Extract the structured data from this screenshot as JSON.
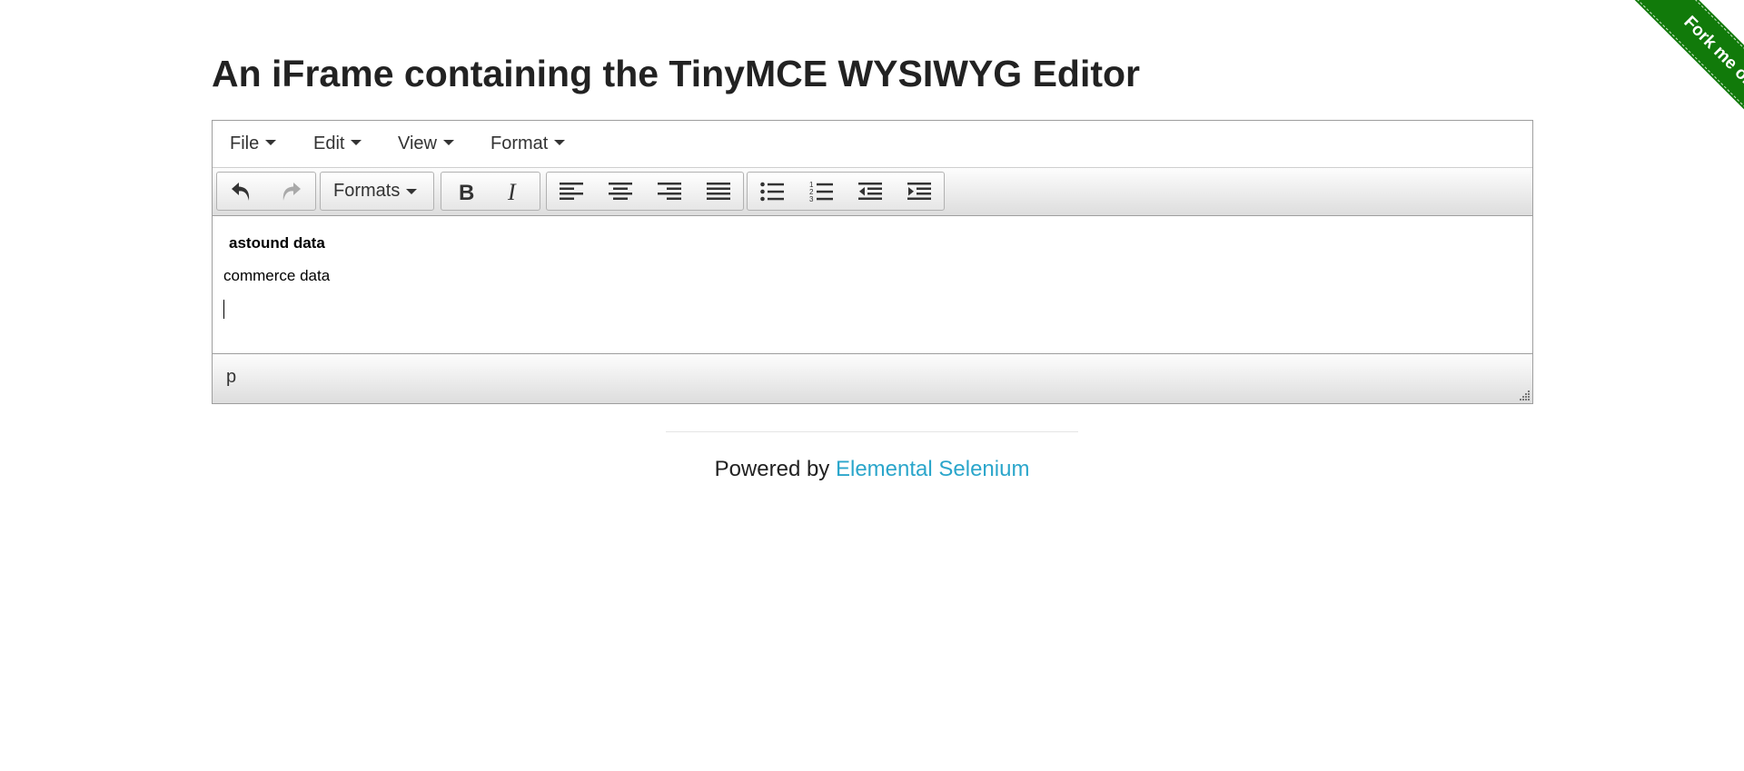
{
  "page": {
    "title": "An iFrame containing the TinyMCE WYSIWYG Editor"
  },
  "ribbon": {
    "label": "Fork me on GitHub",
    "color": "#117a0a"
  },
  "menubar": {
    "items": [
      {
        "label": "File"
      },
      {
        "label": "Edit"
      },
      {
        "label": "View"
      },
      {
        "label": "Format"
      }
    ]
  },
  "toolbar": {
    "formats_label": "Formats",
    "buttons": [
      {
        "icon": "undo-icon",
        "enabled": true
      },
      {
        "icon": "redo-icon",
        "enabled": false
      },
      {
        "icon": "bold-icon",
        "enabled": true
      },
      {
        "icon": "italic-icon",
        "enabled": true
      },
      {
        "icon": "align-left-icon",
        "enabled": true
      },
      {
        "icon": "align-center-icon",
        "enabled": true
      },
      {
        "icon": "align-right-icon",
        "enabled": true
      },
      {
        "icon": "align-justify-icon",
        "enabled": true
      },
      {
        "icon": "bullet-list-icon",
        "enabled": true
      },
      {
        "icon": "numbered-list-icon",
        "enabled": true
      },
      {
        "icon": "outdent-icon",
        "enabled": true
      },
      {
        "icon": "indent-icon",
        "enabled": true
      }
    ]
  },
  "content": {
    "lines": [
      {
        "text": "astound data",
        "bold": true
      },
      {
        "text": "commerce data",
        "bold": false
      }
    ]
  },
  "statusbar": {
    "path": "p"
  },
  "footer": {
    "prefix": "Powered by",
    "link_text": "Elemental Selenium",
    "link_color": "#2ba6cb"
  }
}
